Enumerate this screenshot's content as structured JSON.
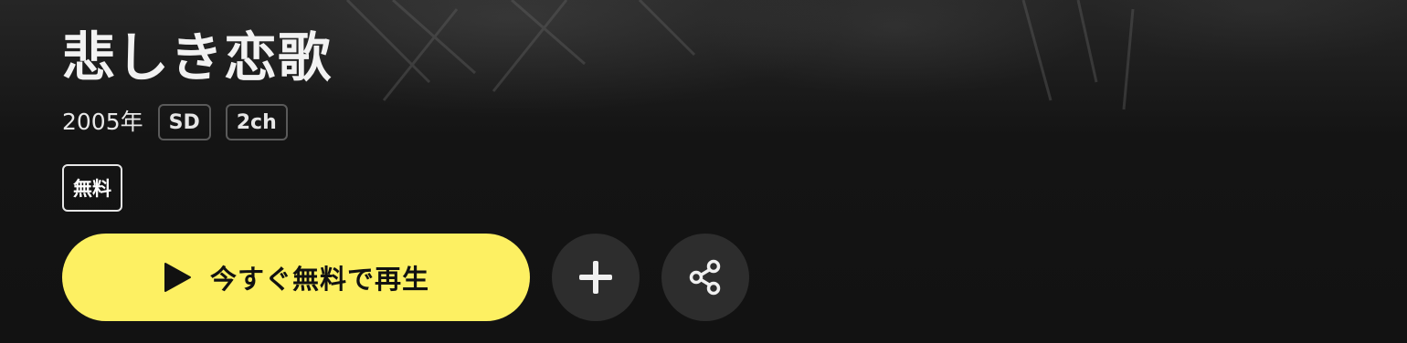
{
  "title": "悲しき恋歌",
  "meta": {
    "year": "2005年",
    "tags": [
      "SD",
      "2ch"
    ]
  },
  "badge": {
    "label": "無料"
  },
  "actions": {
    "play_label": "今すぐ無料で再生",
    "play_icon": "play-icon",
    "add_icon": "plus-icon",
    "share_icon": "share-icon"
  },
  "colors": {
    "play_button_bg": "#fdf062",
    "circle_button_bg": "#2d2d2d",
    "page_bg": "#121212"
  }
}
